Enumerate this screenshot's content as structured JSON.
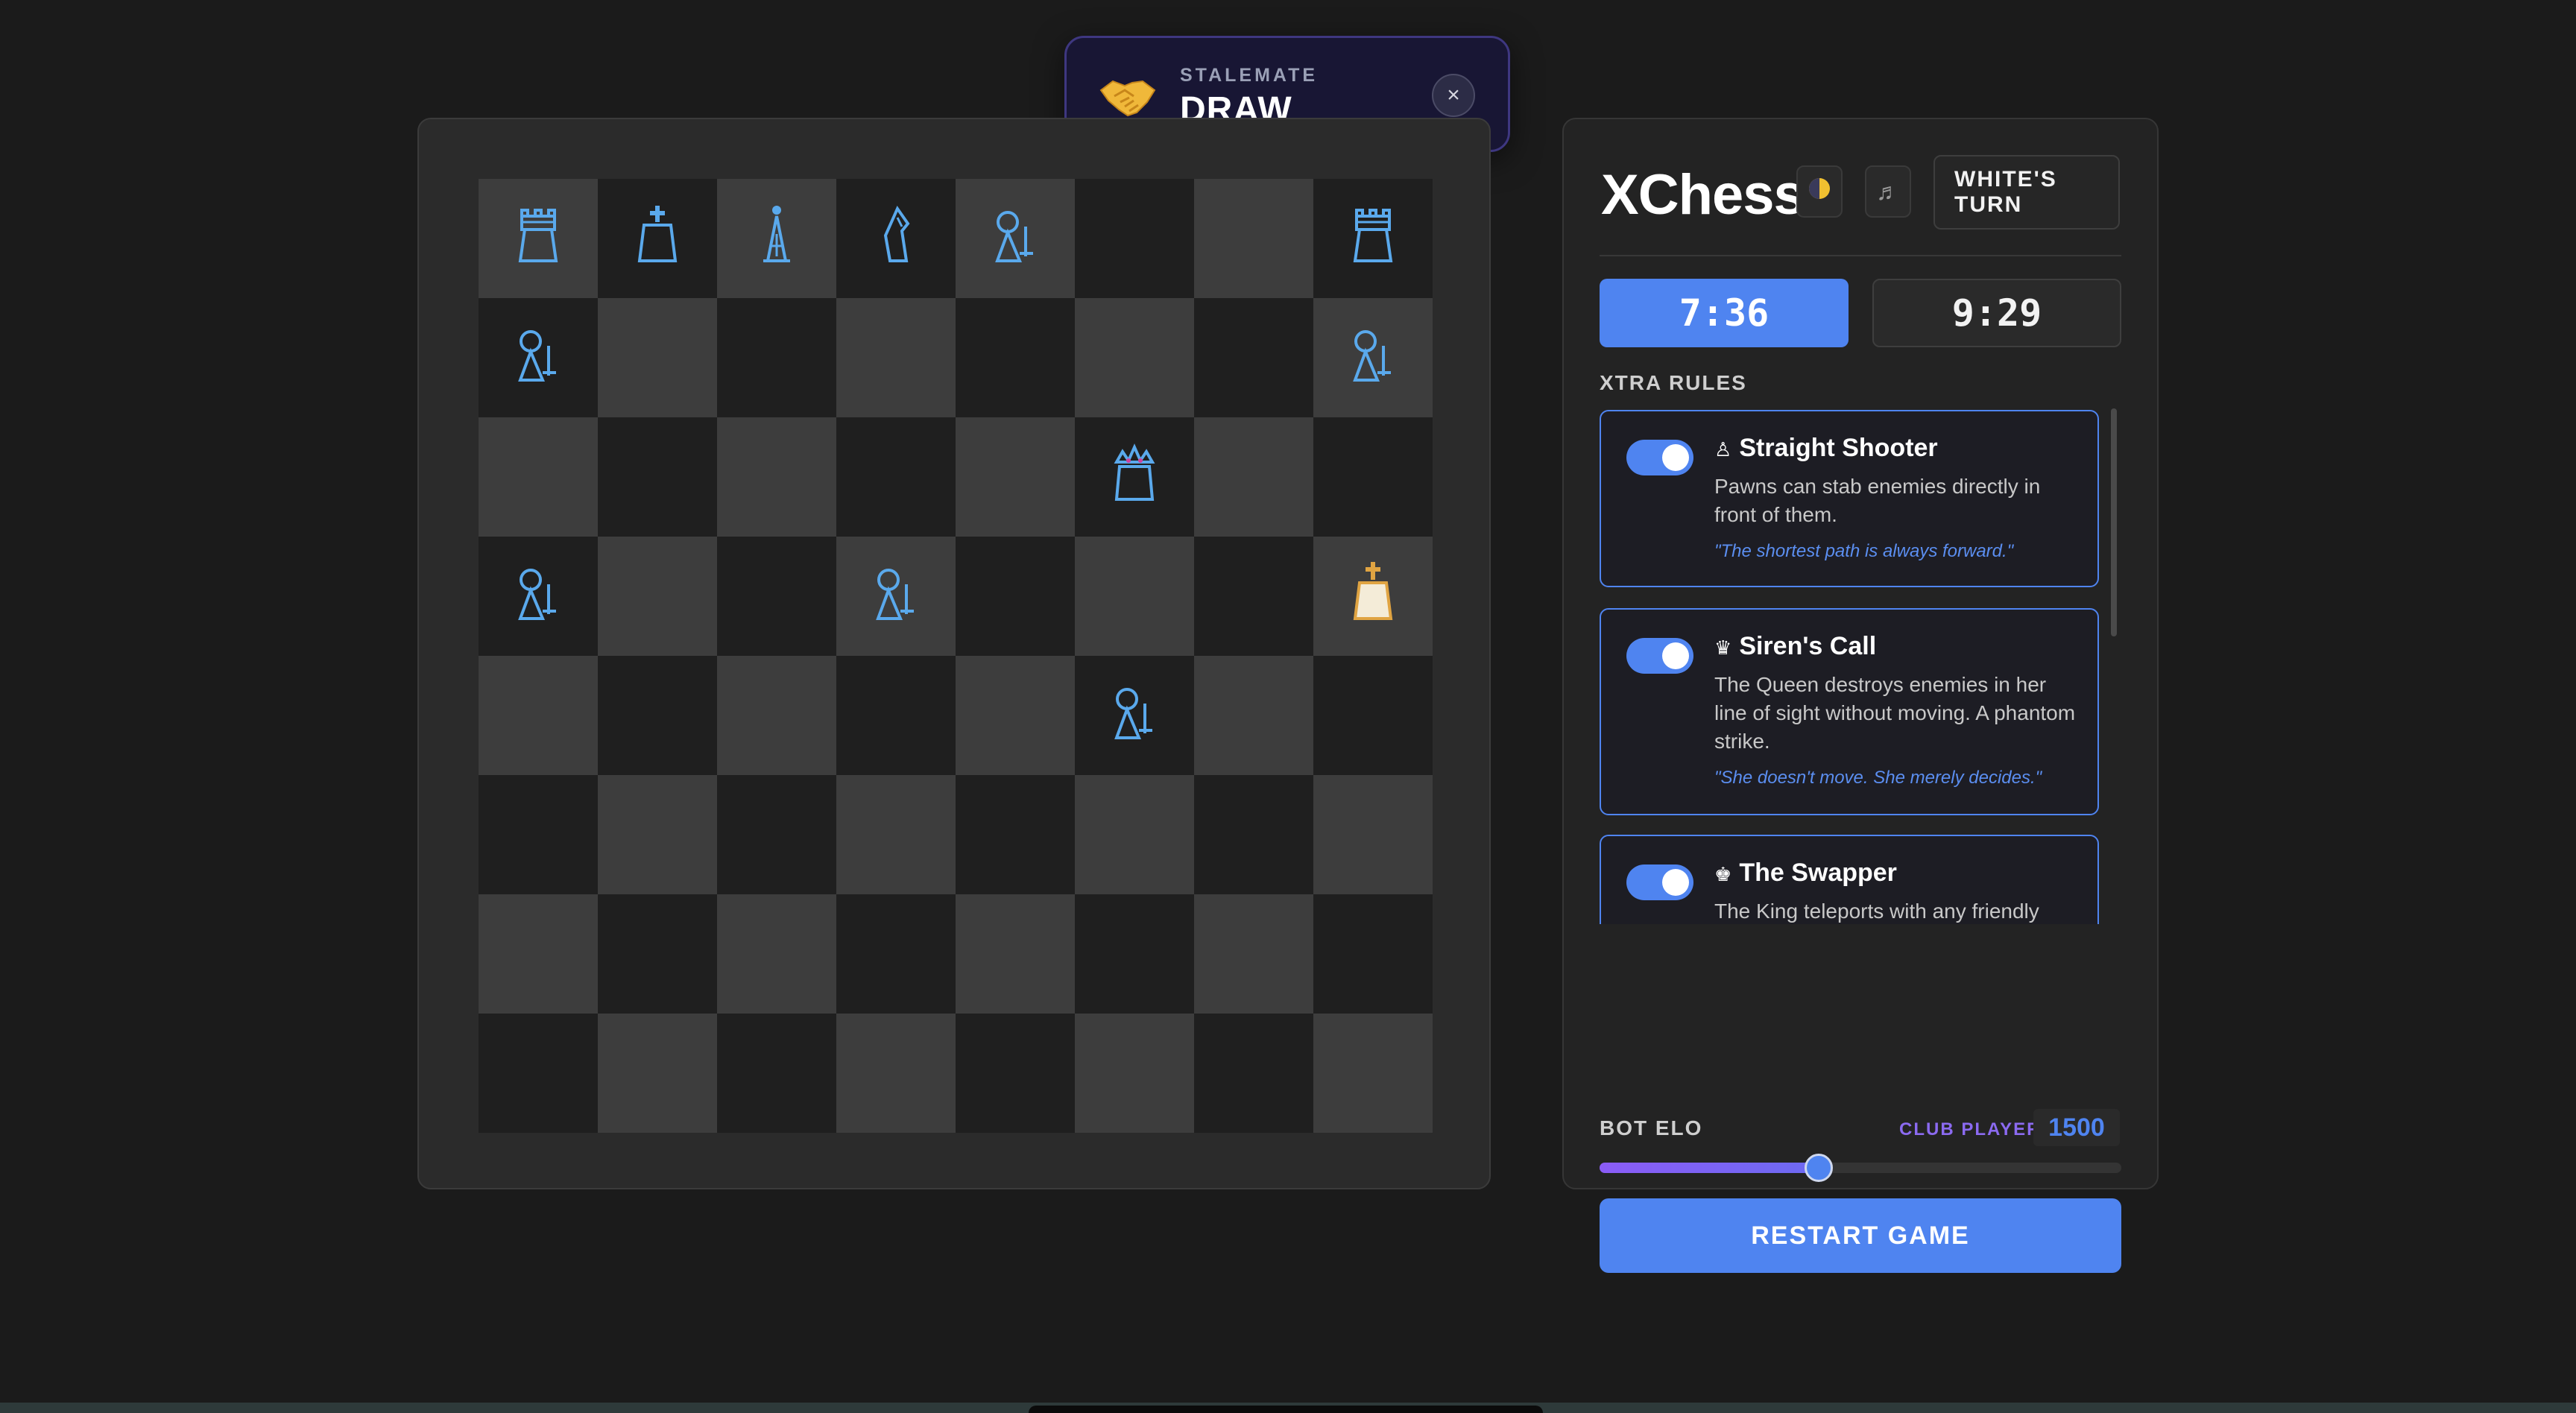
{
  "toast": {
    "kicker": "STALEMATE",
    "title": "DRAW",
    "emoji_icon": "handshake-icon",
    "close_glyph": "×"
  },
  "board": {
    "light_color": "#3d3d3d",
    "dark_color": "#1f1f1f",
    "piece_color_blue": "#5aa9ec",
    "piece_color_gold": "#e0a442",
    "pieces": [
      {
        "square": "a8",
        "type": "rook",
        "color": "blue"
      },
      {
        "square": "b8",
        "type": "king",
        "color": "blue"
      },
      {
        "square": "c8",
        "type": "bishop",
        "color": "blue"
      },
      {
        "square": "d8",
        "type": "knight",
        "color": "blue"
      },
      {
        "square": "e8",
        "type": "pawn",
        "color": "blue"
      },
      {
        "square": "h8",
        "type": "rook",
        "color": "blue"
      },
      {
        "square": "a7",
        "type": "pawn",
        "color": "blue"
      },
      {
        "square": "h7",
        "type": "pawn",
        "color": "blue"
      },
      {
        "square": "f6",
        "type": "queen",
        "color": "blue"
      },
      {
        "square": "a5",
        "type": "pawn",
        "color": "blue"
      },
      {
        "square": "d5",
        "type": "pawn",
        "color": "blue"
      },
      {
        "square": "h5",
        "type": "king",
        "color": "gold"
      },
      {
        "square": "f4",
        "type": "pawn",
        "color": "blue"
      }
    ]
  },
  "panel": {
    "brand": "XChess",
    "theme_icon": "moon-icon",
    "sound_icon": "music-icon",
    "turn_line1": "WHITE'S",
    "turn_line2": "TURN",
    "clock_white": "7:36",
    "clock_black": "9:29",
    "rules_header": "XTRA RULES",
    "rules": [
      {
        "icon": "♙",
        "title": "Straight Shooter",
        "desc": "Pawns can stab enemies directly in front of them.",
        "quote": "\"The shortest path is always forward.\"",
        "enabled": true
      },
      {
        "icon": "♛",
        "title": "Siren's Call",
        "desc": "The Queen destroys enemies in her line of sight without moving. A phantom strike.",
        "quote": "\"She doesn't move. She merely decides.\"",
        "enabled": true
      },
      {
        "icon": "♚",
        "title": "The Swapper",
        "desc": "The King teleports with any friendly piece on the board in one move.",
        "quote": "",
        "enabled": true
      }
    ],
    "elo_label": "BOT ELO",
    "elo_tier": "CLUB PLAYER",
    "elo_value": "1500",
    "elo_fraction": 0.42,
    "restart_label": "RESTART GAME"
  }
}
